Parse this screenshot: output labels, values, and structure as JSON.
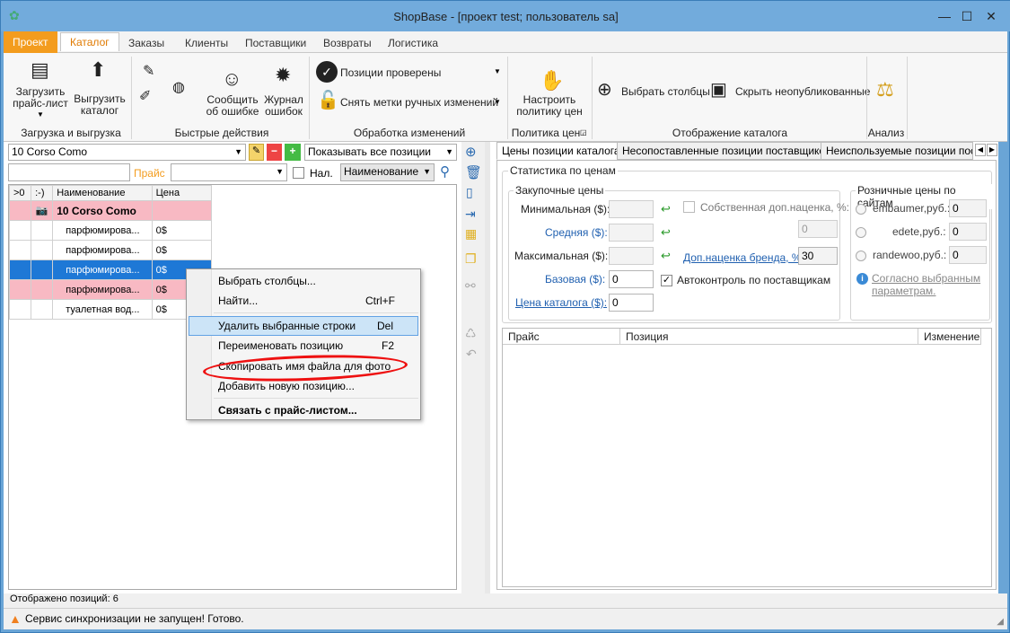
{
  "window": {
    "title": "ShopBase - [проект test; пользователь sa]",
    "min": "—",
    "max": "☐",
    "close": "✕"
  },
  "menu": [
    "Проект",
    "Каталог",
    "Заказы",
    "Клиенты",
    "Поставщики",
    "Возвраты",
    "Логистика"
  ],
  "ribbon": {
    "load_price": "Загрузить прайс-лист",
    "unload_catalog": "Выгрузить каталог",
    "g1": "Загрузка и выгрузка",
    "report_error": "Сообщить об ошибке",
    "error_log": "Журнал ошибок",
    "g2": "Быстрые действия",
    "positions_checked": "Позиции проверены",
    "remove_marks": "Снять метки ручных изменений",
    "g3": "Обработка изменений",
    "setup_policy": "Настроить политику цен",
    "g4": "Политика цен",
    "choose_columns": "Выбрать столбцы",
    "hide_unpublished": "Скрыть неопубликованные",
    "g5": "Отображение каталога",
    "g6": "Анализ"
  },
  "left": {
    "brand": "10 Corso Como",
    "filter": "Показывать все позиции",
    "price_label": "Прайс",
    "nal": "Нал.",
    "sort": "Наименование",
    "headers": [
      ">0",
      ":-)",
      "Наименование",
      "Цена"
    ],
    "group_row": "10 Corso Como",
    "rows": [
      [
        "парфюмирова...",
        "0$"
      ],
      [
        "парфюмирова...",
        "0$"
      ],
      [
        "парфюмирова...",
        "0$"
      ],
      [
        "парфюмирова...",
        "0$"
      ],
      [
        "туалетная вод...",
        "0$"
      ]
    ],
    "shown": "Отображено позиций: 6"
  },
  "context_menu": [
    {
      "label": "Выбрать столбцы...",
      "shortcut": ""
    },
    {
      "label": "Найти...",
      "shortcut": "Ctrl+F"
    },
    {
      "label": "Удалить выбранные строки",
      "shortcut": "Del"
    },
    {
      "label": "Переименовать позицию",
      "shortcut": "F2"
    },
    {
      "label": "Скопировать имя файла для фото",
      "shortcut": ""
    },
    {
      "label": "Добавить новую позицию...",
      "shortcut": ""
    },
    {
      "label": "Связать с прайс-листом...",
      "shortcut": ""
    }
  ],
  "right": {
    "tabs": [
      "Цены позиции каталога",
      "Несопоставленные позиции поставщиков",
      "Неиспользуемые позиции поста"
    ],
    "stats": "Статистика по ценам",
    "purchase": "Закупочные цены",
    "min": "Минимальная ($):",
    "avg": "Средняя ($):",
    "max": "Максимальная ($):",
    "base": "Базовая ($):",
    "catalog": "Цена каталога ($):",
    "base_val": "0",
    "catalog_val": "0",
    "own_markup": "Собственная доп.наценка, %:",
    "own_val": "0",
    "brand_markup": "Доп.наценка бренда, %:",
    "brand_val": "30",
    "autocontrol": "Автоконтроль по поставщикам",
    "retail": "Розничные цены по сайтам",
    "sites": [
      {
        "name": "embaumer,руб.:",
        "val": "0"
      },
      {
        "name": "edete,руб.:",
        "val": "0"
      },
      {
        "name": "randewoo,руб.:",
        "val": "0"
      }
    ],
    "note": "Согласно выбранным параметрам.",
    "cols": [
      "Прайс",
      "Позиция",
      "Изменение"
    ]
  },
  "status": "Сервис синхронизации не запущен!  Готово.",
  "colors": {
    "accent": "#f39c1e",
    "selected": "#1e78d6",
    "pink": "#f8b9c3",
    "red_mark": "#e11"
  }
}
